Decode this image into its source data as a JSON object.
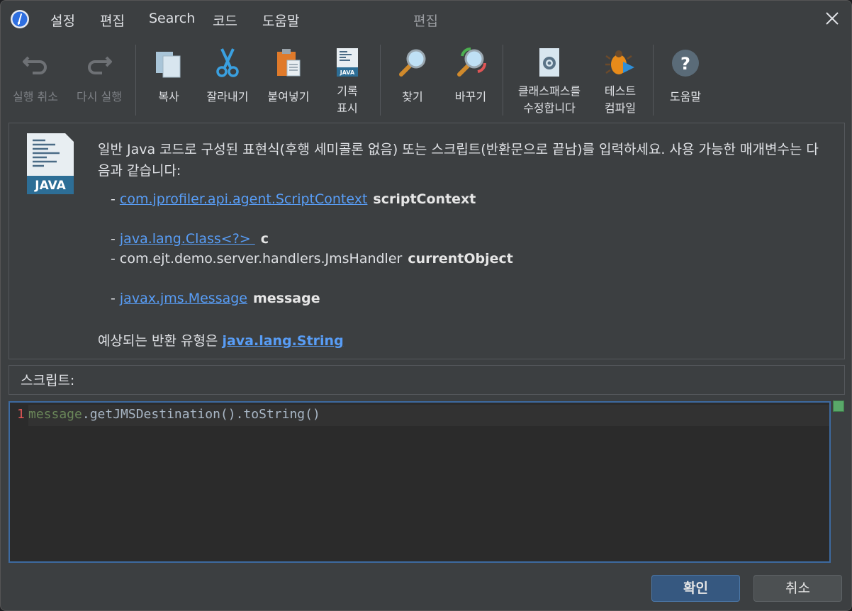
{
  "titlebar": {
    "menu": [
      "설정",
      "편집",
      "Search",
      "코드",
      "도움말"
    ],
    "title": "편집"
  },
  "toolbar": {
    "undo": "실행 취소",
    "redo": "다시 실행",
    "copy": "복사",
    "cut": "잘라내기",
    "paste": "붙여넣기",
    "record_line1": "기록",
    "record_line2": "표시",
    "find": "찾기",
    "replace": "바꾸기",
    "classpath_line1": "클래스패스를",
    "classpath_line2": "수정합니다",
    "test_line1": "테스트",
    "test_line2": "컴파일",
    "help": "도움말"
  },
  "info": {
    "description": "일반 Java 코드로 구성된 표현식(후행 세미콜론 없음) 또는 스크립트(반환문으로 끝남)를 입력하세요. 사용 가능한 매개변수는 다음과 같습니다:",
    "params": [
      {
        "prefix": "- ",
        "type": "com.jprofiler.api.agent.ScriptContext",
        "name": "scriptContext",
        "link": true
      },
      {
        "prefix": "- ",
        "type": "java.lang.Class<?> ",
        "name": "c",
        "link": true
      },
      {
        "prefix": "- ",
        "type": "com.ejt.demo.server.handlers.JmsHandler",
        "name": "currentObject",
        "link": false
      },
      {
        "prefix": "- ",
        "type": "javax.jms.Message",
        "name": "message",
        "link": true
      }
    ],
    "return_prefix": "예상되는 반환 유형은 ",
    "return_type": "java.lang.String"
  },
  "script": {
    "label": "스크립트:",
    "line_number": "1",
    "code_var": "message",
    "code_rest": ".getJMSDestination().toString()"
  },
  "buttons": {
    "ok": "확인",
    "cancel": "취소"
  },
  "colors": {
    "link": "#589df6",
    "editor_border": "#3d6aa0",
    "ok_button": "#365880"
  }
}
